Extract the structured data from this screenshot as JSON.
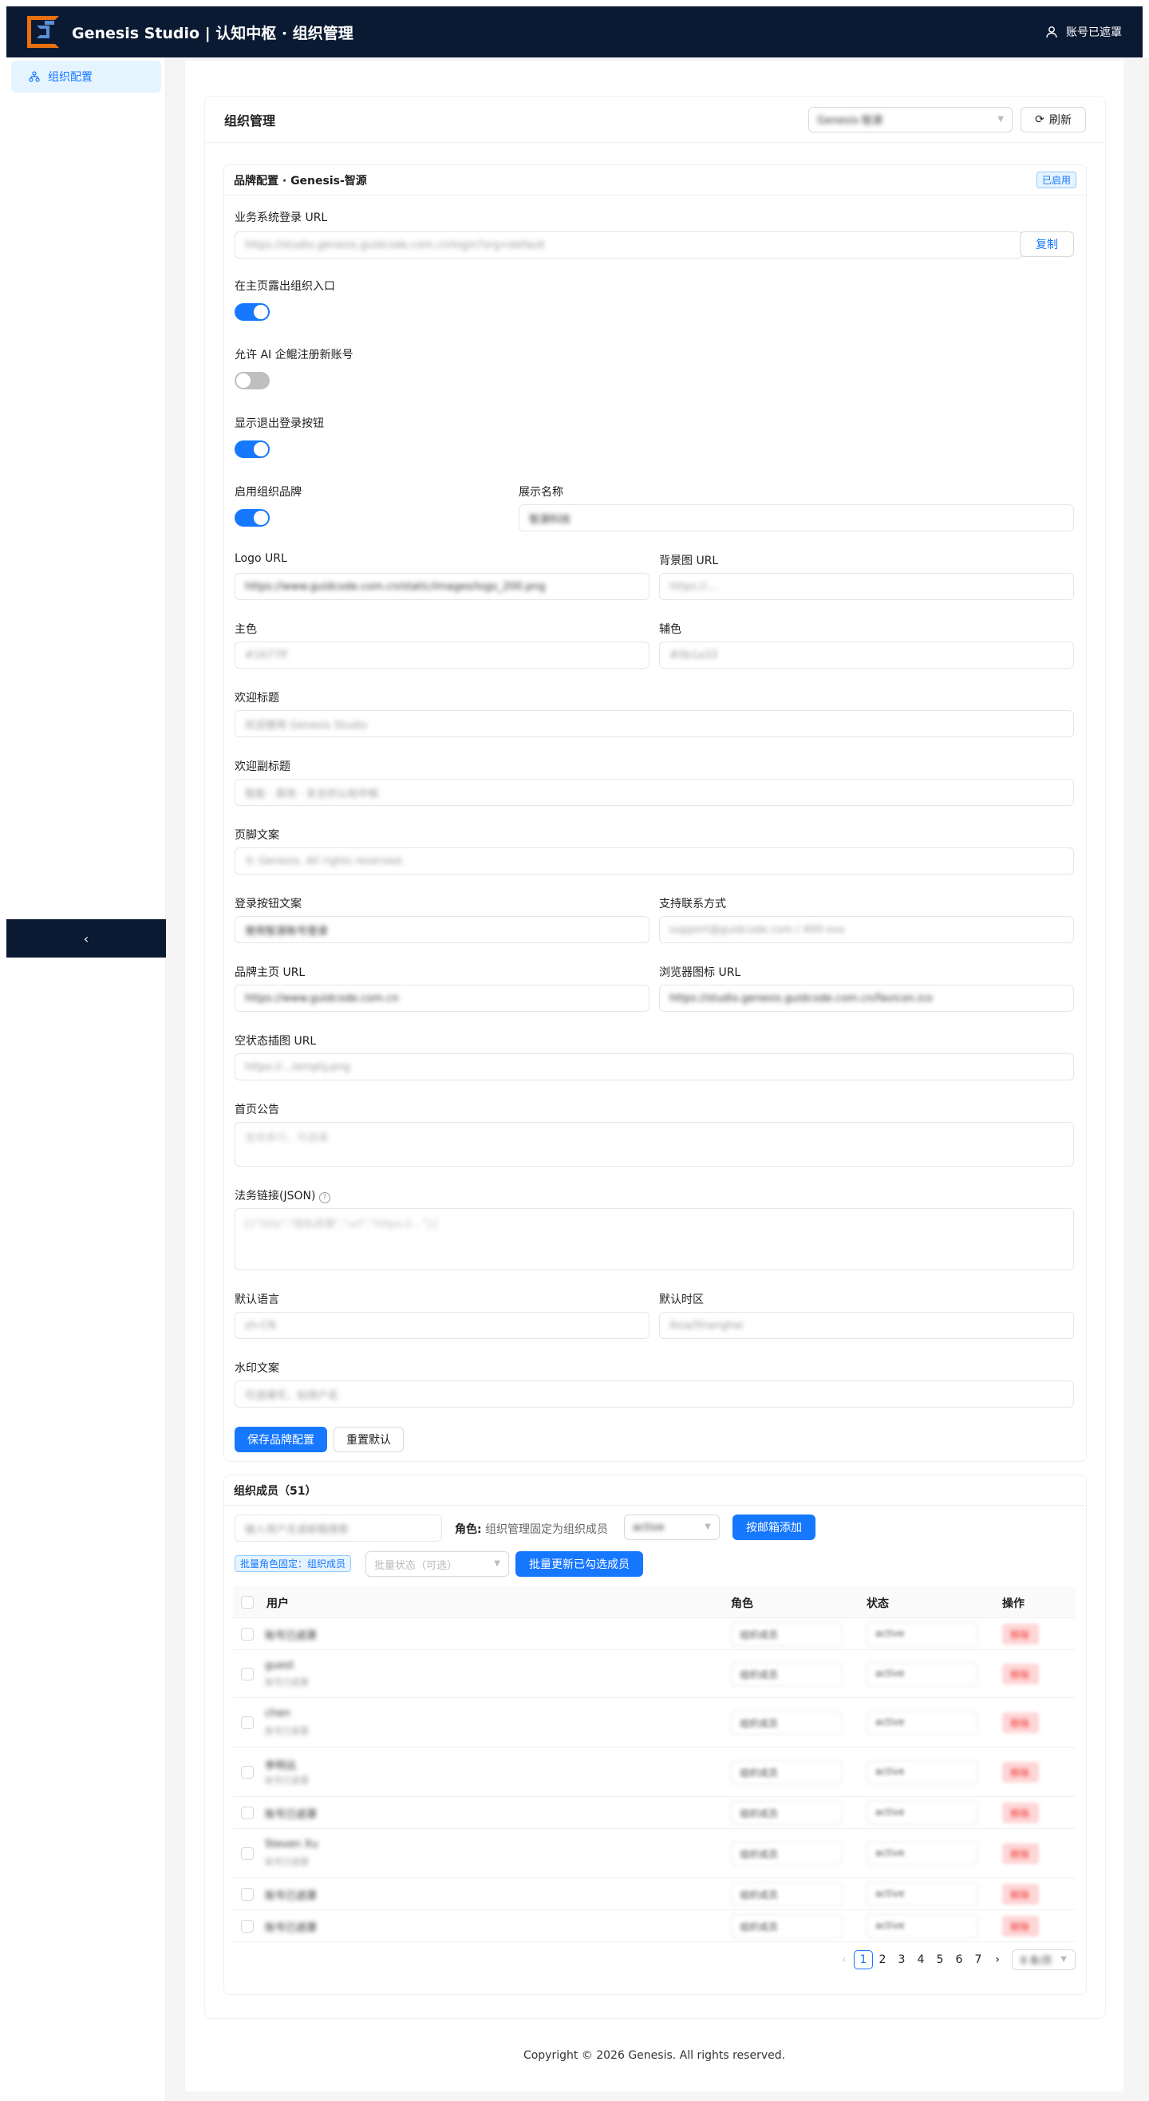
{
  "app": {
    "title": "Genesis Studio | 认知中枢 · 组织管理",
    "user_label": "账号已遮罩"
  },
  "sidebar": {
    "items": [
      {
        "label": "组织配置"
      }
    ],
    "collapse_icon": "‹"
  },
  "page": {
    "title": "组织管理",
    "org_select_value": "Genesis-智源",
    "refresh_label": "刷新"
  },
  "brand": {
    "header": "品牌配置 · Genesis-智源",
    "status_tag": "已启用",
    "login_url_label": "业务系统登录 URL",
    "login_url_value": "https://studio.genesis.guidcode.com.cn/login?org=default",
    "copy_label": "复制",
    "show_org_entry_label": "在主页露出组织入口",
    "show_org_entry": true,
    "allow_register_label": "允许 AI 企鲲注册新账号",
    "allow_register": false,
    "show_logout_label": "显示退出登录按钮",
    "show_logout": true,
    "enable_brand_label": "启用组织品牌",
    "enable_brand": true,
    "display_name_label": "展示名称",
    "display_name_value": "智源科技",
    "logo_url_label": "Logo URL",
    "logo_url_value": "https://www.guidcode.com.cn/static/images/logo_200.png",
    "bg_url_label": "背景图 URL",
    "bg_url_placeholder": "https://...",
    "primary_color_label": "主色",
    "primary_color_placeholder": "#1677ff",
    "secondary_color_label": "辅色",
    "secondary_color_placeholder": "#0b1a33",
    "welcome_title_label": "欢迎标题",
    "welcome_title_placeholder": "欢迎使用 Genesis Studio",
    "welcome_subtitle_label": "欢迎副标题",
    "welcome_subtitle_placeholder": "智能 · 高效 · 安全的认知中枢",
    "footer_text_label": "页脚文案",
    "footer_text_placeholder": "© Genesis. All rights reserved.",
    "login_btn_label": "登录按钮文案",
    "login_btn_value": "使用智源账号登录",
    "support_label": "支持联系方式",
    "support_placeholder": "support@guidcode.com / 400-xxx",
    "home_url_label": "品牌主页 URL",
    "home_url_value": "https://www.guidcode.com.cn",
    "favicon_label": "浏览器图标 URL",
    "favicon_value": "https://studio.genesis.guidcode.com.cn/favicon.ico",
    "empty_img_label": "空状态插图 URL",
    "empty_img_placeholder": "https://.../empty.png",
    "notice_label": "首页公告",
    "notice_placeholder": "支持多行，可选填",
    "legal_label": "法务链接(JSON)",
    "legal_placeholder": "[{\"title\":\"隐私政策\",\"url\":\"https://...\"}]",
    "lang_label": "默认语言",
    "lang_placeholder": "zh-CN",
    "tz_label": "默认时区",
    "tz_placeholder": "Asia/Shanghai",
    "watermark_label": "水印文案",
    "watermark_placeholder": "可选填写，如用户名",
    "save_label": "保存品牌配置",
    "reset_label": "重置默认"
  },
  "members": {
    "header": "组织成员（51）",
    "search_placeholder": "输入用户名或邮箱搜索",
    "role_label": "角色:",
    "role_hint": "组织管理固定为组织成员",
    "status_select_value": "active",
    "add_by_email_label": "按邮箱添加",
    "batch_role_tag": "批量角色固定：组织成员",
    "batch_status_placeholder": "批量状态（可选）",
    "batch_update_label": "批量更新已勾选成员",
    "columns": {
      "user": "用户",
      "role": "角色",
      "status": "状态",
      "action": "操作"
    },
    "rows": [
      {
        "name": "账号已遮罩",
        "sub": "",
        "role": "组织成员",
        "status": "active",
        "action": "移除"
      },
      {
        "name": "guest",
        "sub": "账号已遮罩",
        "role": "组织成员",
        "status": "active",
        "action": "移除"
      },
      {
        "name": "chen",
        "sub": "账号已遮罩",
        "role": "组织成员",
        "status": "active",
        "action": "移除"
      },
      {
        "name": "李明远",
        "sub": "账号已遮罩",
        "role": "组织成员",
        "status": "active",
        "action": "移除"
      },
      {
        "name": "账号已遮罩",
        "sub": "",
        "role": "组织成员",
        "status": "active",
        "action": "移除"
      },
      {
        "name": "Steven Xu",
        "sub": "账号已遮罩",
        "role": "组织成员",
        "status": "active",
        "action": "移除"
      },
      {
        "name": "账号已遮罩",
        "sub": "",
        "role": "组织成员",
        "status": "active",
        "action": "移除"
      },
      {
        "name": "账号已遮罩",
        "sub": "",
        "role": "组织成员",
        "status": "active",
        "action": "移除"
      }
    ],
    "pages": [
      "1",
      "2",
      "3",
      "4",
      "5",
      "6",
      "7"
    ],
    "current_page": "1",
    "page_size_value": "8 条/页"
  },
  "footer": "Copyright © 2026 Genesis. All rights reserved."
}
